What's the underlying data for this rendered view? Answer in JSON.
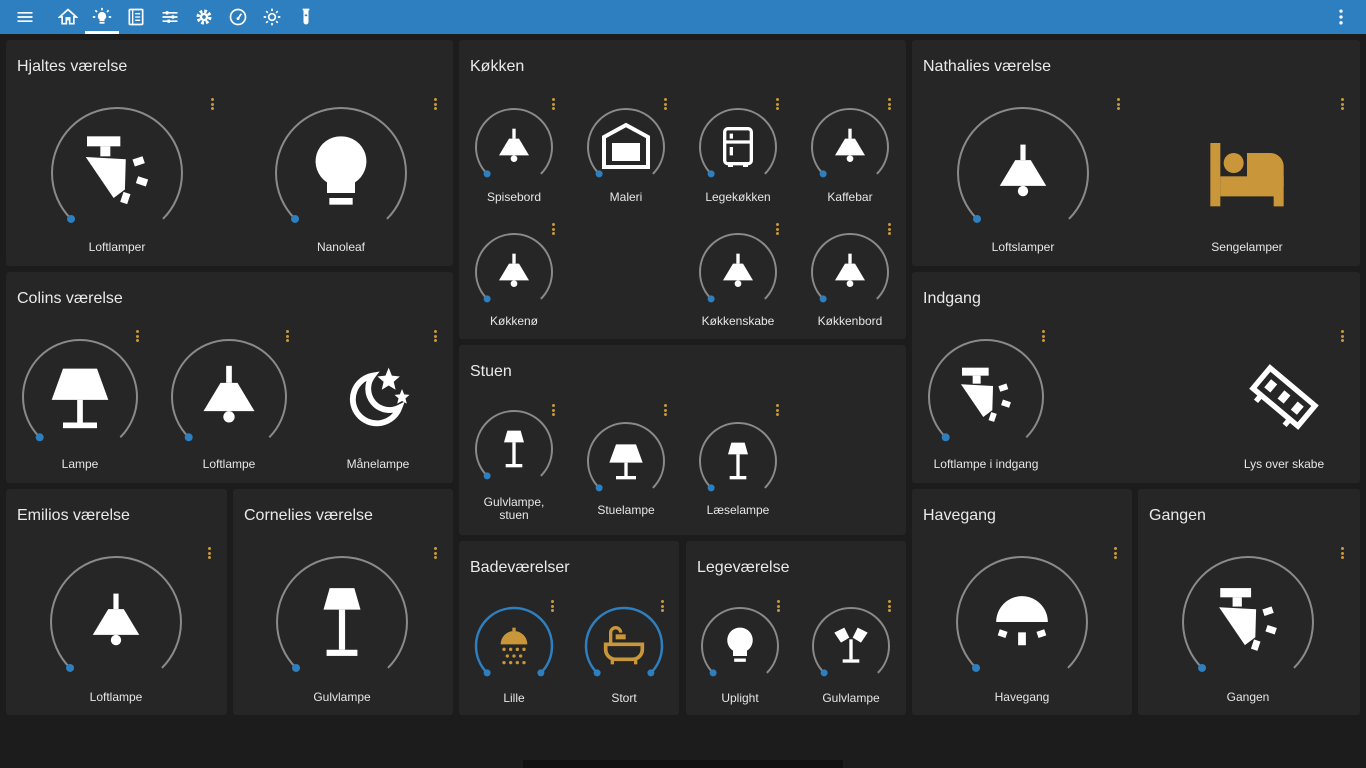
{
  "toolbar": {
    "icons": [
      "menu-icon",
      "home-icon",
      "lightbulb-icon",
      "book-icon",
      "sliders-icon",
      "gear-icon",
      "gauge-icon",
      "sun-icon",
      "test-tube-icon"
    ],
    "overflow_icon": "more-vertical-icon"
  },
  "colors": {
    "accent": "#2e7fbf",
    "card": "#262626",
    "dots": "#c9973a",
    "ring": "#8a8a8a",
    "knob": "#2e7fbf",
    "gold_icon": "#c9973a"
  },
  "cards": [
    {
      "id": "hjalte",
      "title": "Hjaltes værelse",
      "tiles": [
        {
          "label": "Loftlamper",
          "icon": "spotlight-icon"
        },
        {
          "label": "Nanoleaf",
          "icon": "bulb-icon"
        }
      ]
    },
    {
      "id": "colin",
      "title": "Colins værelse",
      "tiles": [
        {
          "label": "Lampe",
          "icon": "table-lamp-icon"
        },
        {
          "label": "Loftlampe",
          "icon": "ceiling-lamp-icon"
        },
        {
          "label": "Månelampe",
          "icon": "moon-stars-icon"
        }
      ]
    },
    {
      "id": "emilio",
      "title": "Emilios værelse",
      "tiles": [
        {
          "label": "Loftlampe",
          "icon": "ceiling-lamp-icon"
        }
      ]
    },
    {
      "id": "cornelie",
      "title": "Cornelies værelse",
      "tiles": [
        {
          "label": "Gulvlampe",
          "icon": "floor-lamp-icon"
        }
      ]
    },
    {
      "id": "kokken",
      "title": "Køkken",
      "tiles": [
        {
          "label": "Spisebord",
          "icon": "ceiling-lamp-icon"
        },
        {
          "label": "Maleri",
          "icon": "picture-lamp-icon"
        },
        {
          "label": "Legekøkken",
          "icon": "fridge-icon"
        },
        {
          "label": "Kaffebar",
          "icon": "ceiling-lamp-icon"
        },
        {
          "label": "Køkkenø",
          "icon": "ceiling-lamp-icon"
        },
        {
          "label": "Køkkenskabe",
          "icon": "ceiling-lamp-icon"
        },
        {
          "label": "Køkkenbord",
          "icon": "ceiling-lamp-icon"
        }
      ]
    },
    {
      "id": "stuen",
      "title": "Stuen",
      "tiles": [
        {
          "label": "Gulvlampe, stuen",
          "line1": "Gulvlampe,",
          "line2": "stuen",
          "icon": "floor-lamp-icon"
        },
        {
          "label": "Stuelampe",
          "icon": "table-lamp-icon"
        },
        {
          "label": "Læselampe",
          "icon": "floor-lamp-icon"
        }
      ]
    },
    {
      "id": "bade",
      "title": "Badeværelser",
      "tiles": [
        {
          "label": "Lille",
          "icon": "shower-icon"
        },
        {
          "label": "Stort",
          "icon": "bathtub-icon"
        }
      ]
    },
    {
      "id": "lege",
      "title": "Legeværelse",
      "tiles": [
        {
          "label": "Uplight",
          "icon": "bulb-icon"
        },
        {
          "label": "Gulvlampe",
          "icon": "floor-spotlights-icon"
        }
      ]
    },
    {
      "id": "nathalie",
      "title": "Nathalies værelse",
      "tiles": [
        {
          "label": "Loftslamper",
          "icon": "ceiling-lamp-icon"
        },
        {
          "label": "Sengelamper",
          "icon": "bed-icon"
        }
      ]
    },
    {
      "id": "indgang",
      "title": "Indgang",
      "tiles": [
        {
          "label": "Loftlampe i indgang",
          "icon": "spotlight-icon"
        },
        {
          "label": "Lys over skabe",
          "icon": "led-strip-icon"
        }
      ]
    },
    {
      "id": "havegang",
      "title": "Havegang",
      "tiles": [
        {
          "label": "Havegang",
          "icon": "dome-lamp-icon"
        }
      ]
    },
    {
      "id": "gangen",
      "title": "Gangen",
      "tiles": [
        {
          "label": "Gangen",
          "icon": "spotlight-icon"
        }
      ]
    }
  ]
}
